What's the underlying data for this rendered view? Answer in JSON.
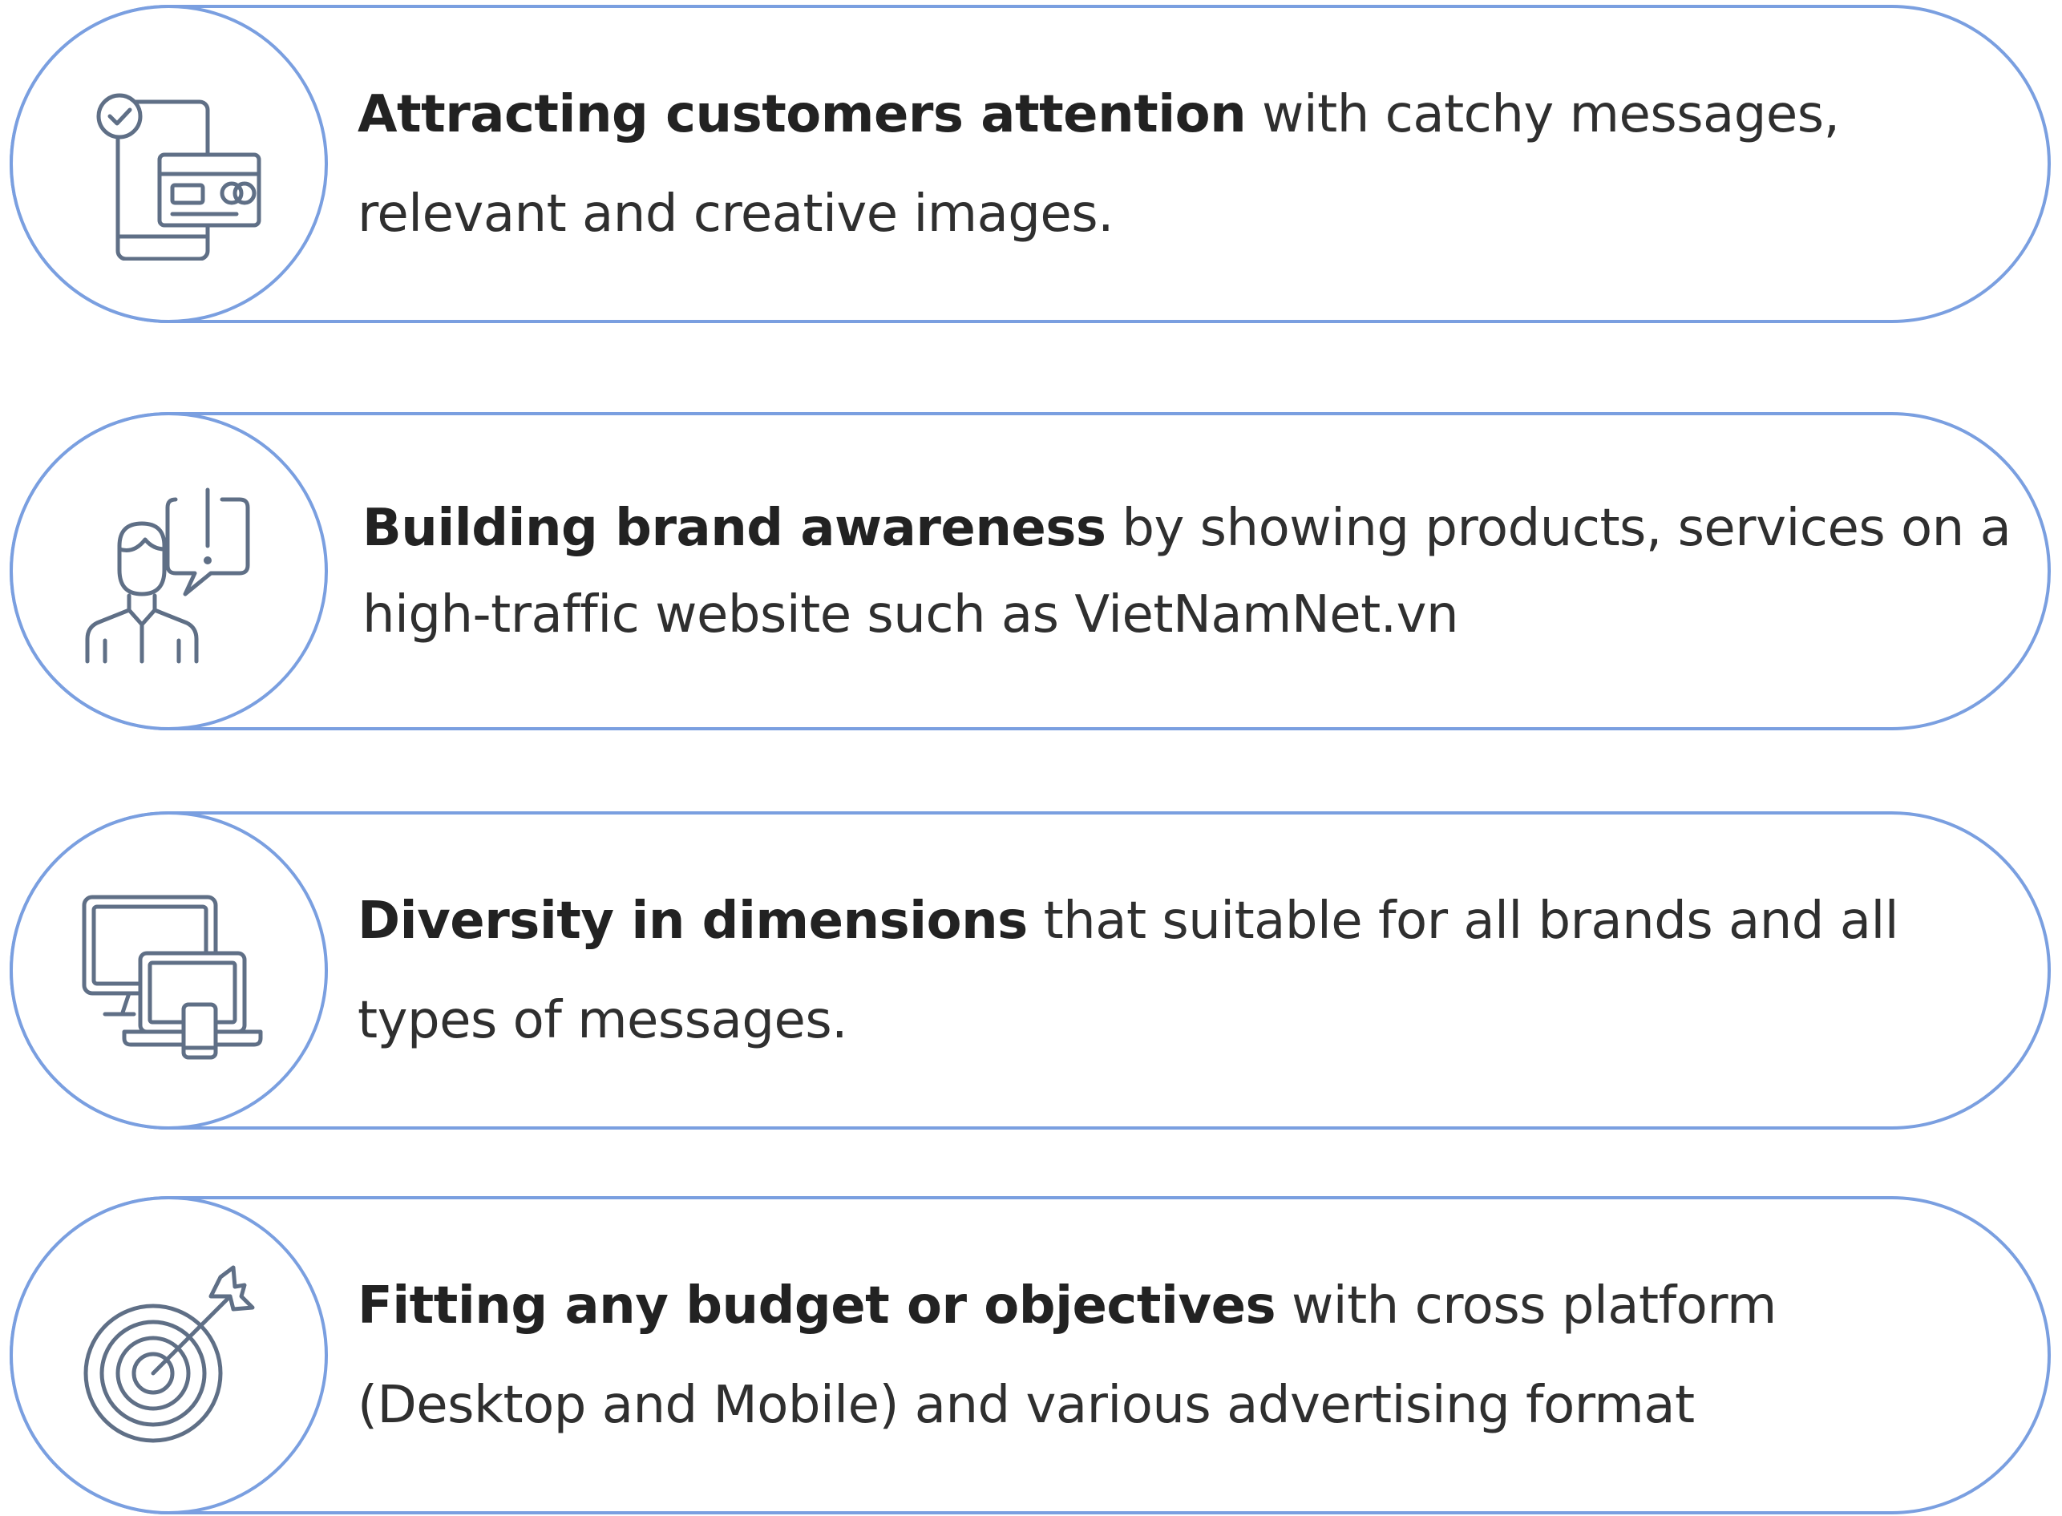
{
  "colors": {
    "outline": "#7a9fe0",
    "icon": "#5f6f86",
    "text": "#2b2b2b"
  },
  "benefits": [
    {
      "icon": "mobile-payment-card-icon",
      "bold": "Attracting customers attention",
      "text": " with catchy messages, relevant and creative images."
    },
    {
      "icon": "person-speech-exclamation-icon",
      "bold": "Building brand awareness",
      "text": " by showing products, services on a high-traffic website such as VietNamNet.vn"
    },
    {
      "icon": "multi-device-icon",
      "bold": "Diversity in dimensions",
      "text": " that suitable for all brands and all types of messages."
    },
    {
      "icon": "target-arrow-icon",
      "bold": "Fitting any budget or objectives",
      "text": " with cross platform (Desktop and Mobile) and various advertising format"
    }
  ]
}
